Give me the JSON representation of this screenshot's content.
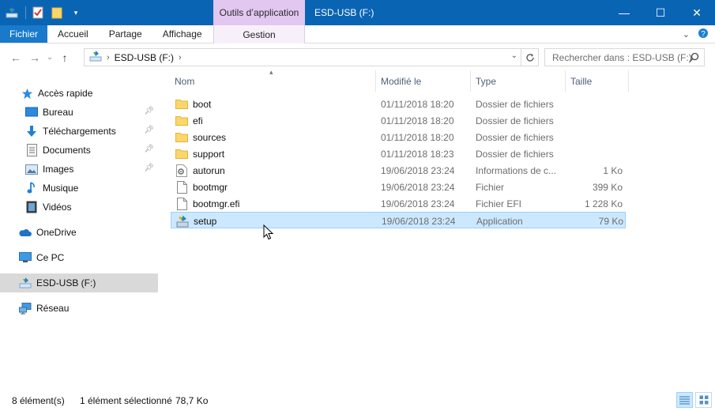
{
  "window": {
    "title": "ESD-USB (F:)",
    "context_tab_group": "Outils d’application",
    "controls": {
      "minimize": "—",
      "maximize": "☐",
      "close": "✕"
    }
  },
  "ribbon": {
    "tabs": [
      {
        "label": "Fichier"
      },
      {
        "label": "Accueil"
      },
      {
        "label": "Partage"
      },
      {
        "label": "Affichage"
      }
    ],
    "context_tab": "Gestion",
    "collapse_icon": "chevron-down-icon",
    "help_icon": "help-icon"
  },
  "address": {
    "segments": [
      "ESD-USB (F:)"
    ],
    "search_placeholder": "Rechercher dans : ESD-USB (F:)"
  },
  "navpane": {
    "items": [
      {
        "label": "Accès rapide",
        "icon": "star-icon",
        "pinned": false
      },
      {
        "label": "Bureau",
        "icon": "desktop-icon",
        "pinned": true
      },
      {
        "label": "Téléchargements",
        "icon": "download-icon",
        "pinned": true
      },
      {
        "label": "Documents",
        "icon": "documents-icon",
        "pinned": true
      },
      {
        "label": "Images",
        "icon": "images-icon",
        "pinned": true
      },
      {
        "label": "Musique",
        "icon": "music-icon",
        "pinned": false
      },
      {
        "label": "Vidéos",
        "icon": "videos-icon",
        "pinned": false
      },
      {
        "label": "OneDrive",
        "icon": "cloud-icon",
        "pinned": false
      },
      {
        "label": "Ce PC",
        "icon": "computer-icon",
        "pinned": false
      },
      {
        "label": "ESD-USB (F:)",
        "icon": "usb-drive-icon",
        "pinned": false
      },
      {
        "label": "Réseau",
        "icon": "network-icon",
        "pinned": false
      }
    ]
  },
  "filelist": {
    "columns": {
      "name": "Nom",
      "date": "Modifié le",
      "type": "Type",
      "size": "Taille"
    },
    "rows": [
      {
        "name": "boot",
        "date": "01/11/2018 18:20",
        "type": "Dossier de fichiers",
        "size": "",
        "icon": "folder-icon"
      },
      {
        "name": "efi",
        "date": "01/11/2018 18:20",
        "type": "Dossier de fichiers",
        "size": "",
        "icon": "folder-icon"
      },
      {
        "name": "sources",
        "date": "01/11/2018 18:20",
        "type": "Dossier de fichiers",
        "size": "",
        "icon": "folder-icon"
      },
      {
        "name": "support",
        "date": "01/11/2018 18:23",
        "type": "Dossier de fichiers",
        "size": "",
        "icon": "folder-icon"
      },
      {
        "name": "autorun",
        "date": "19/06/2018 23:24",
        "type": "Informations de c...",
        "size": "1 Ko",
        "icon": "settings-file-icon"
      },
      {
        "name": "bootmgr",
        "date": "19/06/2018 23:24",
        "type": "Fichier",
        "size": "399 Ko",
        "icon": "file-icon"
      },
      {
        "name": "bootmgr.efi",
        "date": "19/06/2018 23:24",
        "type": "Fichier EFI",
        "size": "1 228 Ko",
        "icon": "file-icon"
      },
      {
        "name": "setup",
        "date": "19/06/2018 23:24",
        "type": "Application",
        "size": "79 Ko",
        "icon": "setup-app-icon"
      }
    ],
    "selected_index": 7
  },
  "status": {
    "count": "8 élément(s)",
    "selection": "1 élément sélectionné",
    "size": "78,7 Ko"
  }
}
